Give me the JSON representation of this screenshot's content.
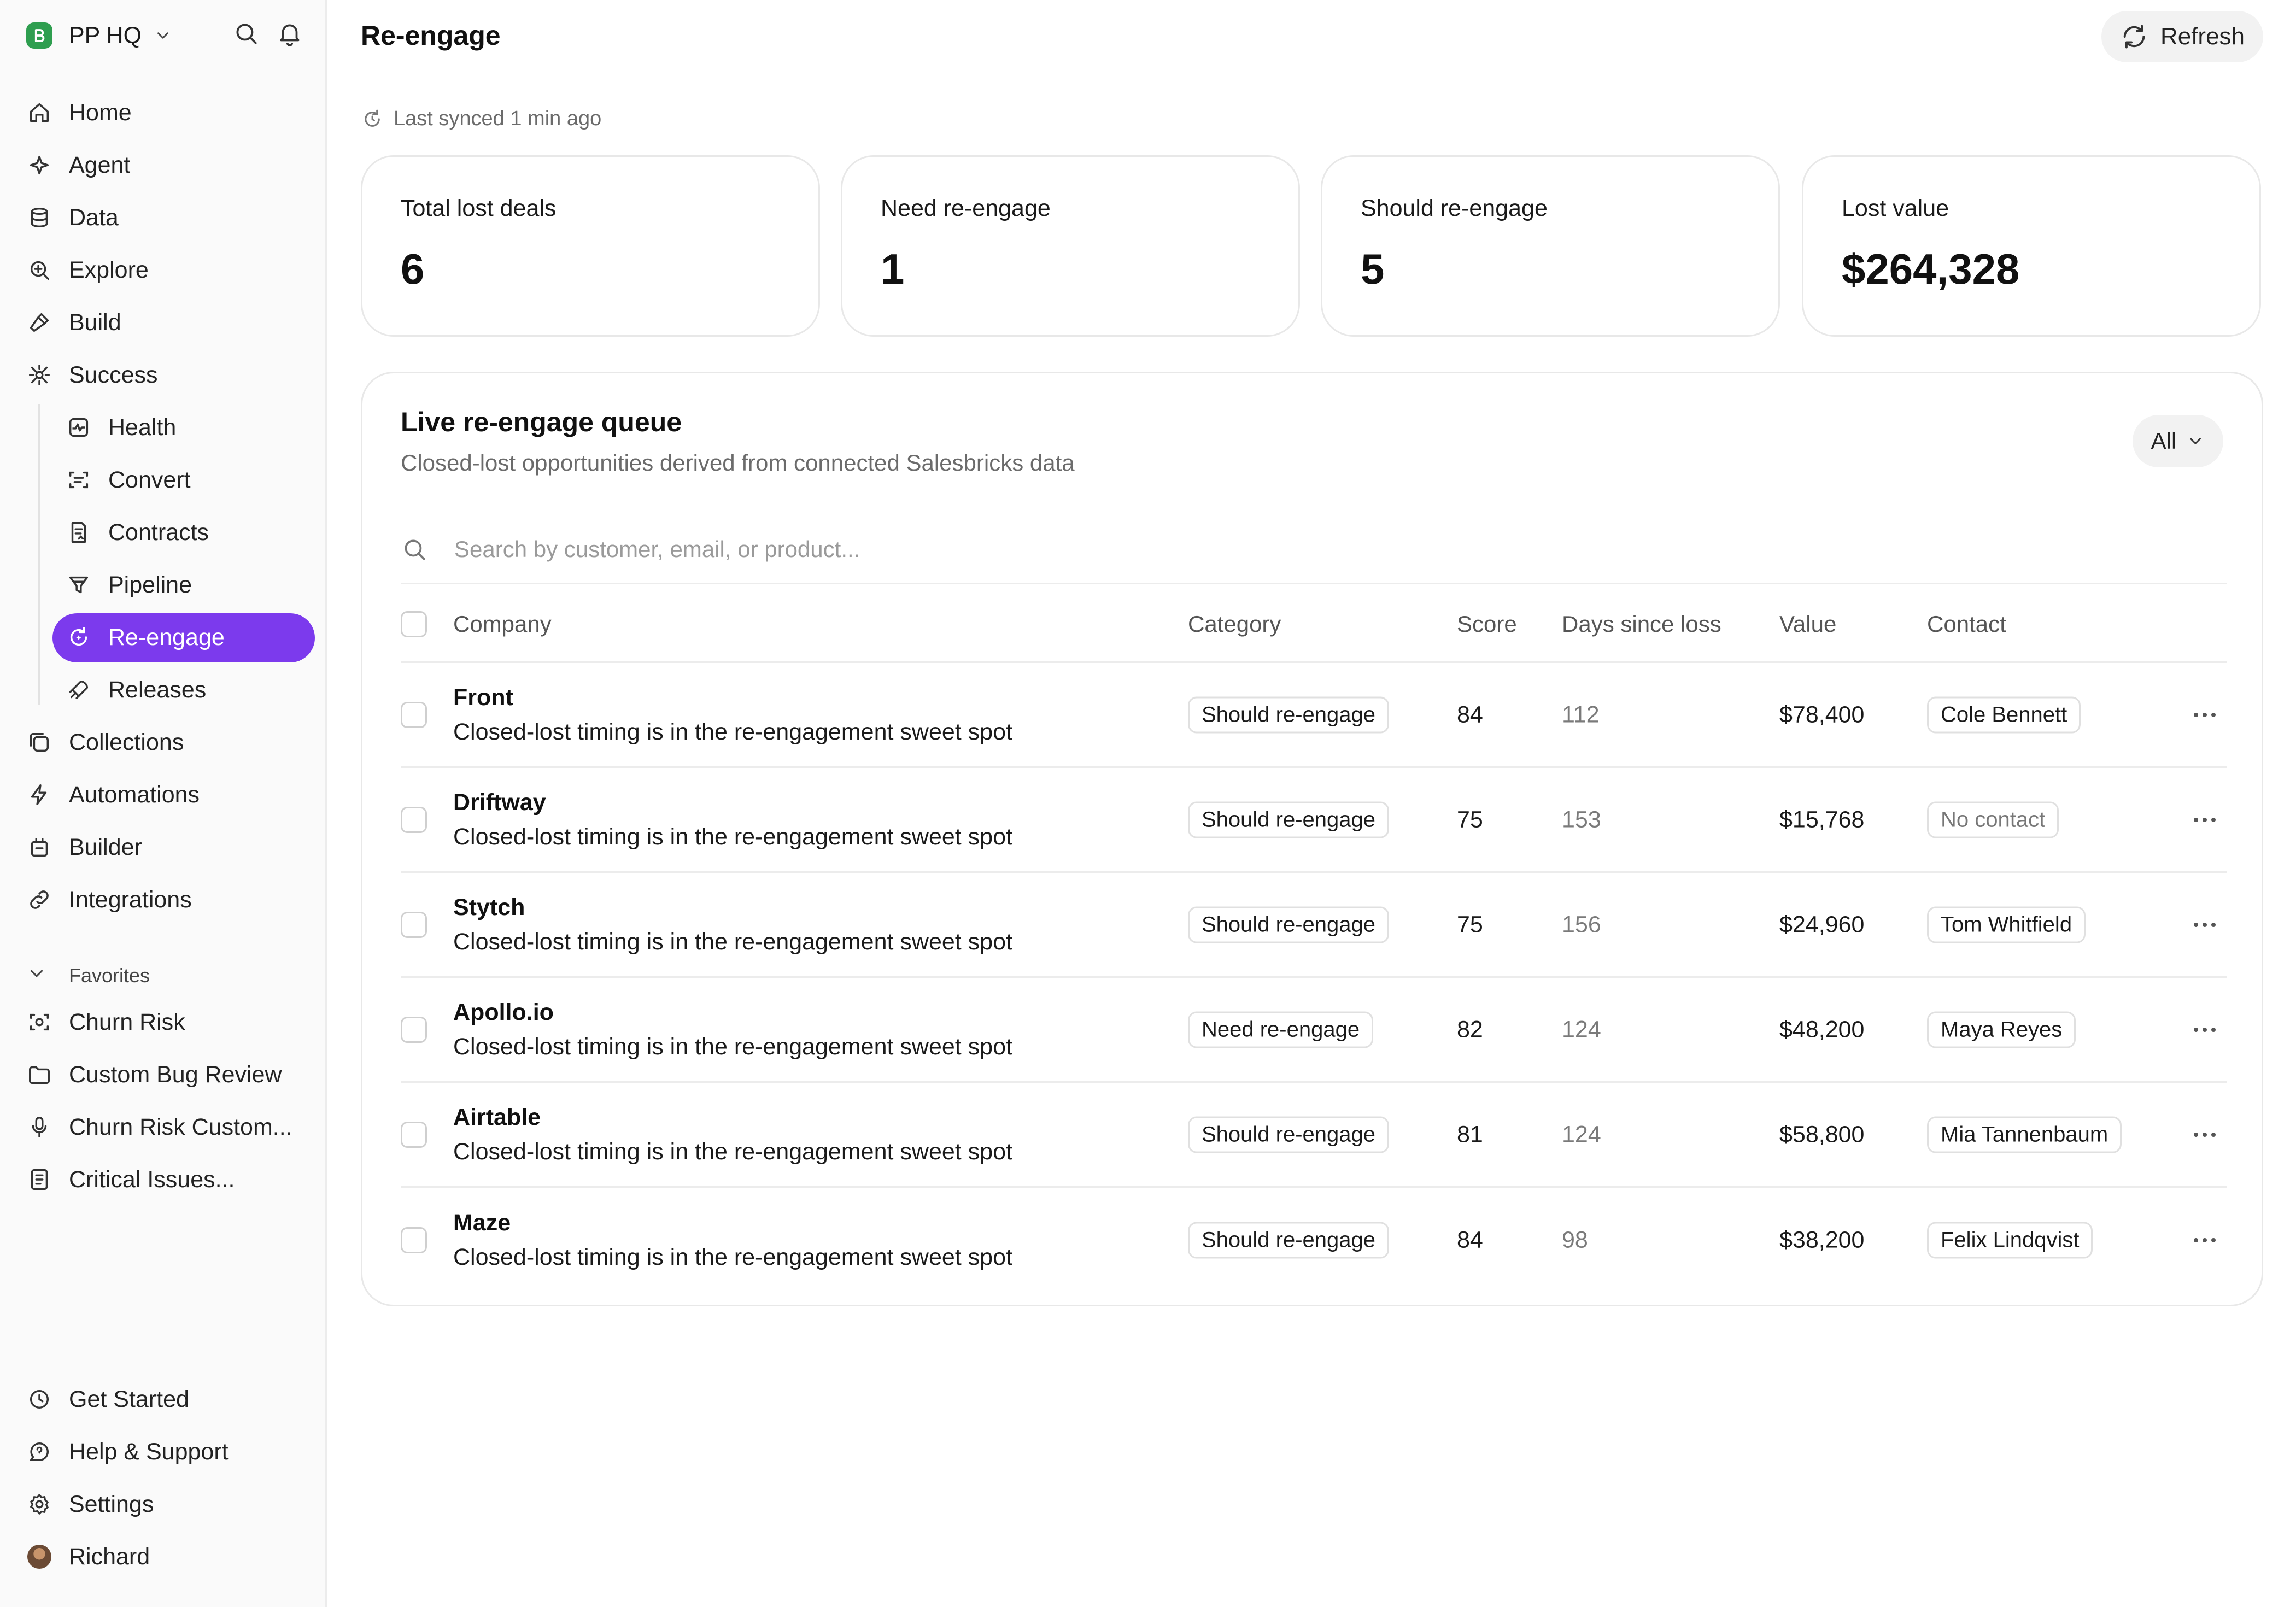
{
  "workspace": {
    "name": "PP HQ"
  },
  "nav": {
    "main": [
      {
        "label": "Home",
        "icon": "home-icon"
      },
      {
        "label": "Agent",
        "icon": "sparkle-icon"
      },
      {
        "label": "Data",
        "icon": "database-icon"
      },
      {
        "label": "Explore",
        "icon": "zoom-in-icon"
      },
      {
        "label": "Build",
        "icon": "hammer-icon"
      },
      {
        "label": "Success",
        "icon": "success-icon"
      }
    ],
    "success_sub": [
      {
        "label": "Health",
        "icon": "activity-icon"
      },
      {
        "label": "Convert",
        "icon": "scan-icon"
      },
      {
        "label": "Contracts",
        "icon": "contract-icon"
      },
      {
        "label": "Pipeline",
        "icon": "funnel-icon"
      },
      {
        "label": "Re-engage",
        "icon": "refresh-spark-icon",
        "active": true
      },
      {
        "label": "Releases",
        "icon": "rocket-icon"
      }
    ],
    "secondary": [
      {
        "label": "Collections",
        "icon": "collections-icon"
      },
      {
        "label": "Automations",
        "icon": "bolt-icon"
      },
      {
        "label": "Builder",
        "icon": "builder-icon"
      },
      {
        "label": "Integrations",
        "icon": "link-icon"
      }
    ],
    "favorites_label": "Favorites",
    "favorites": [
      {
        "label": "Churn Risk",
        "icon": "dashed-scan-icon"
      },
      {
        "label": "Custom Bug Review",
        "icon": "folder-icon"
      },
      {
        "label": "Churn Risk Custom...",
        "icon": "microphone-icon"
      },
      {
        "label": "Critical Issues...",
        "icon": "document-icon"
      }
    ],
    "bottom": [
      {
        "label": "Get Started",
        "icon": "clock-icon"
      },
      {
        "label": "Help & Support",
        "icon": "chat-icon"
      },
      {
        "label": "Settings",
        "icon": "gear-icon"
      },
      {
        "label": "Richard",
        "icon": "avatar"
      }
    ]
  },
  "header": {
    "title": "Re-engage",
    "refresh_label": "Refresh"
  },
  "sync": {
    "text": "Last synced 1 min ago"
  },
  "stats": [
    {
      "label": "Total lost deals",
      "value": "6"
    },
    {
      "label": "Need re-engage",
      "value": "1"
    },
    {
      "label": "Should re-engage",
      "value": "5"
    },
    {
      "label": "Lost value",
      "value": "$264,328"
    }
  ],
  "queue": {
    "title": "Live re-engage queue",
    "subtitle": "Closed-lost opportunities derived from connected Salesbricks data",
    "filter_label": "All",
    "search_placeholder": "Search by customer, email, or product...",
    "columns": {
      "company": "Company",
      "category": "Category",
      "score": "Score",
      "days": "Days since loss",
      "value": "Value",
      "contact": "Contact"
    },
    "rows": [
      {
        "company": "Front",
        "reason": "Closed-lost timing is in the re-engagement sweet spot",
        "category": "Should re-engage",
        "score": "84",
        "days": "112",
        "value": "$78,400",
        "contact": "Cole Bennett"
      },
      {
        "company": "Driftway",
        "reason": "Closed-lost timing is in the re-engagement sweet spot",
        "category": "Should re-engage",
        "score": "75",
        "days": "153",
        "value": "$15,768",
        "contact": "No contact"
      },
      {
        "company": "Stytch",
        "reason": "Closed-lost timing is in the re-engagement sweet spot",
        "category": "Should re-engage",
        "score": "75",
        "days": "156",
        "value": "$24,960",
        "contact": "Tom Whitfield"
      },
      {
        "company": "Apollo.io",
        "reason": "Closed-lost timing is in the re-engagement sweet spot",
        "category": "Need re-engage",
        "score": "82",
        "days": "124",
        "value": "$48,200",
        "contact": "Maya Reyes"
      },
      {
        "company": "Airtable",
        "reason": "Closed-lost timing is in the re-engagement sweet spot",
        "category": "Should re-engage",
        "score": "81",
        "days": "124",
        "value": "$58,800",
        "contact": "Mia Tannenbaum"
      },
      {
        "company": "Maze",
        "reason": "Closed-lost timing is in the re-engagement sweet spot",
        "category": "Should re-engage",
        "score": "84",
        "days": "98",
        "value": "$38,200",
        "contact": "Felix Lindqvist"
      }
    ]
  },
  "colors": {
    "accent": "#7c3aed",
    "brand": "#2e9e4f"
  }
}
